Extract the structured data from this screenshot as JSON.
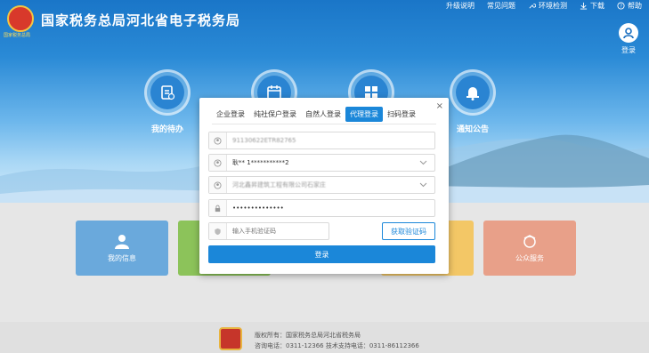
{
  "header": {
    "logo_caption": "国家税务总局",
    "title": "国家税务总局河北省电子税务局",
    "links": [
      {
        "label": "升级说明",
        "icon": ""
      },
      {
        "label": "常见问题",
        "icon": ""
      },
      {
        "label": "环境检测",
        "icon": "wrench-icon"
      },
      {
        "label": "下载",
        "icon": "download-icon"
      },
      {
        "label": "帮助",
        "icon": "help-icon"
      }
    ],
    "login_label": "登录"
  },
  "features": [
    {
      "label": "我的待办",
      "icon": "todo-icon"
    },
    {
      "label": "",
      "icon": "calendar-icon"
    },
    {
      "label": "",
      "icon": "grid-icon"
    },
    {
      "label": "通知公告",
      "icon": "bell-icon"
    }
  ],
  "tiles": [
    {
      "label": "我的信息",
      "color": "#6aa9dc"
    },
    {
      "label": "",
      "color": "#8cc35a"
    },
    {
      "label": "",
      "color": "#f3c766"
    },
    {
      "label": "公众服务",
      "color": "#e8a089"
    }
  ],
  "dialog": {
    "tabs": [
      "企业登录",
      "纯社保户登录",
      "自然人登录",
      "代理登录",
      "扫码登录"
    ],
    "active_tab": 3,
    "field1_value": "91130622ETR82765",
    "field2_value": "耿** 1***********2",
    "field3_value": "河北鑫昇建筑工程有限公司石家庄",
    "password_value": "••••••••••••••",
    "sms_placeholder": "输入手机验证码",
    "sms_button": "获取验证码",
    "login_button": "登录",
    "close_symbol": "×"
  },
  "footer": {
    "line1": "版权所有：国家税务总局河北省税务局",
    "line2": "咨询电话：0311-12366  技术支持电话：0311-86112366"
  },
  "colors": {
    "accent": "#1b87d9"
  }
}
